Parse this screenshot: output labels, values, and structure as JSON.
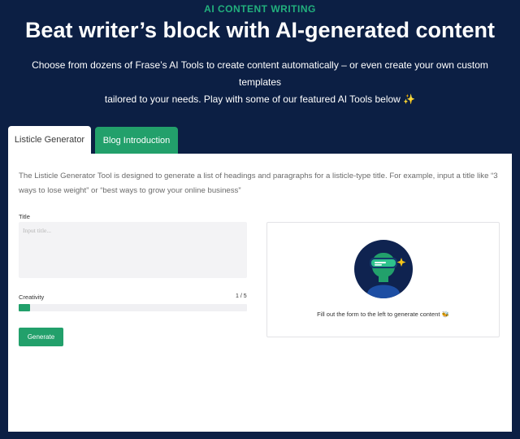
{
  "header": {
    "eyebrow": "AI CONTENT WRITING",
    "headline": "Beat writer’s block with AI-generated content",
    "subhead_line1": "Choose from dozens of Frase’s AI Tools to create content automatically – or even create your own custom templates",
    "subhead_line2": "tailored to your needs. Play with some of our featured AI Tools below",
    "subhead_emoji": "✨"
  },
  "tabs": [
    {
      "label": "Listicle Generator",
      "active": true
    },
    {
      "label": "Blog Introduction",
      "active": false
    }
  ],
  "panel": {
    "description": "The Listicle Generator Tool is designed to generate a list of headings and paragraphs for a listicle-type title. For example, input a title like “3 ways to lose weight” or “best ways to grow your online business”",
    "title_label": "Title",
    "title_placeholder": "Input title...",
    "title_value": "",
    "creativity_label": "Creativity",
    "creativity_value": "1 / 5",
    "creativity_level": 0.2,
    "generate_label": "Generate",
    "output_message": "Fill out the form to the left to generate content",
    "output_emoji": "🐝"
  },
  "colors": {
    "background": "#0c1f44",
    "accent": "#22a06b",
    "eyebrow": "#22b07d"
  },
  "icons": {
    "robot": "robot-avatar-icon",
    "sparkle": "sparkle-icon",
    "bee": "bee-icon"
  }
}
